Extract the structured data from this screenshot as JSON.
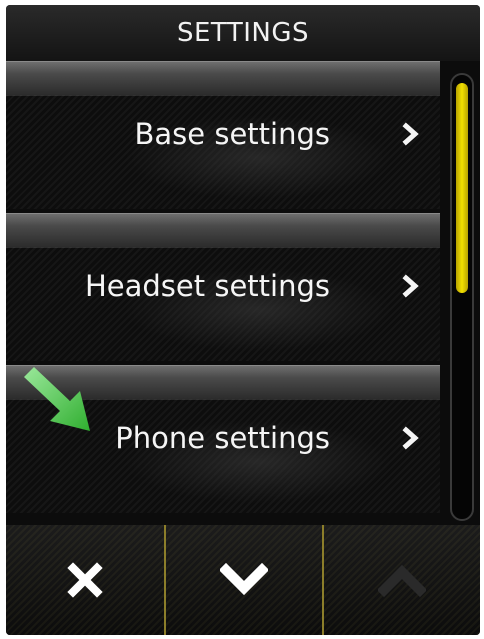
{
  "header": {
    "title": "SETTINGS"
  },
  "menu": {
    "items": [
      {
        "label": "Base settings",
        "chevron": "chevron-right-icon"
      },
      {
        "label": "Headset settings",
        "chevron": "chevron-right-icon"
      },
      {
        "label": "Phone settings",
        "chevron": "chevron-right-icon"
      }
    ]
  },
  "scrollbar": {
    "thumb_color": "#f2e000"
  },
  "hint": {
    "icon": "green-arrow-icon",
    "color": "#3cc43c"
  },
  "softkeys": [
    {
      "icon": "close-icon",
      "enabled": true
    },
    {
      "icon": "chevron-down-icon",
      "enabled": true
    },
    {
      "icon": "chevron-up-icon",
      "enabled": false
    }
  ]
}
